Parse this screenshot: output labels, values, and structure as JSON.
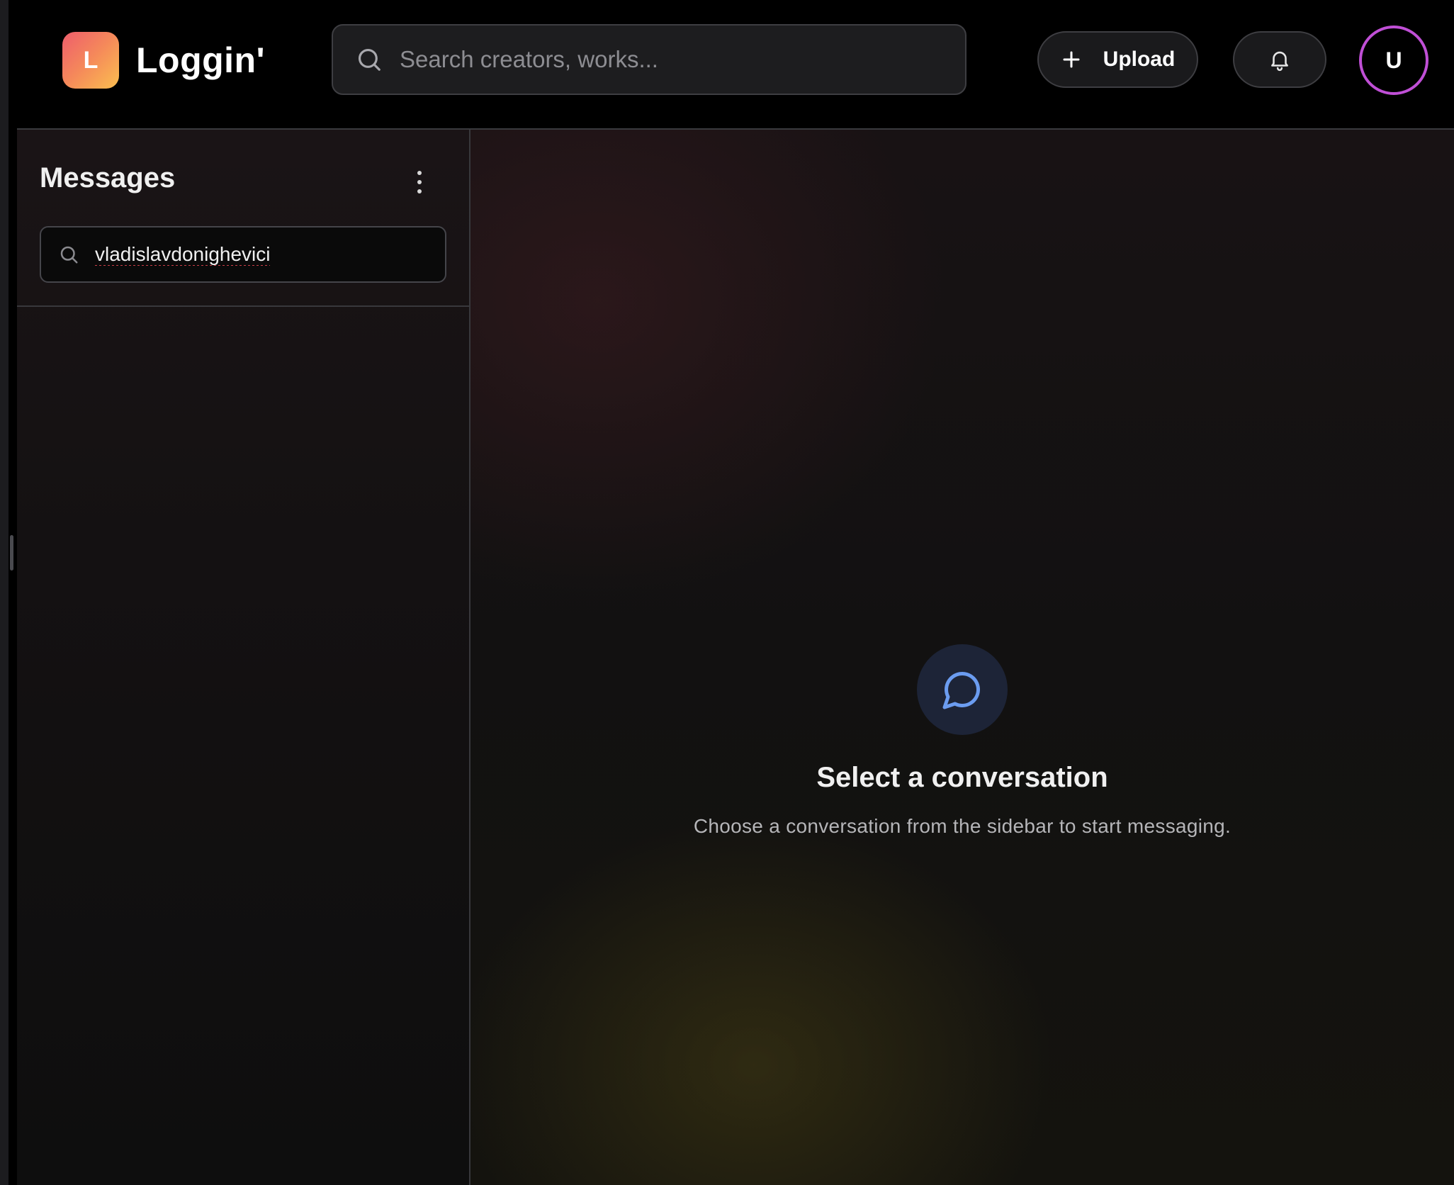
{
  "app": {
    "brand_initial": "L",
    "brand_name": "Loggin'"
  },
  "topbar": {
    "search_placeholder": "Search creators, works...",
    "upload_label": "Upload",
    "avatar_initial": "U"
  },
  "sidebar": {
    "title": "Messages",
    "search_value": "vladislavdonighevici"
  },
  "main": {
    "empty_title": "Select a conversation",
    "empty_subtitle": "Choose a conversation from the sidebar to start messaging."
  },
  "colors": {
    "background": "#000000",
    "brand_gradient_start": "#ee5d6c",
    "brand_gradient_end": "#fbbf50",
    "avatar_ring": "#c04fd6",
    "chat_icon": "#6b9cf0"
  },
  "icons": {
    "global_search": "search-icon",
    "upload": "plus-icon",
    "notifications": "bell-icon",
    "sidebar_menu": "more-vertical-icon",
    "conversation_search": "search-icon",
    "empty_state": "message-circle-icon"
  }
}
